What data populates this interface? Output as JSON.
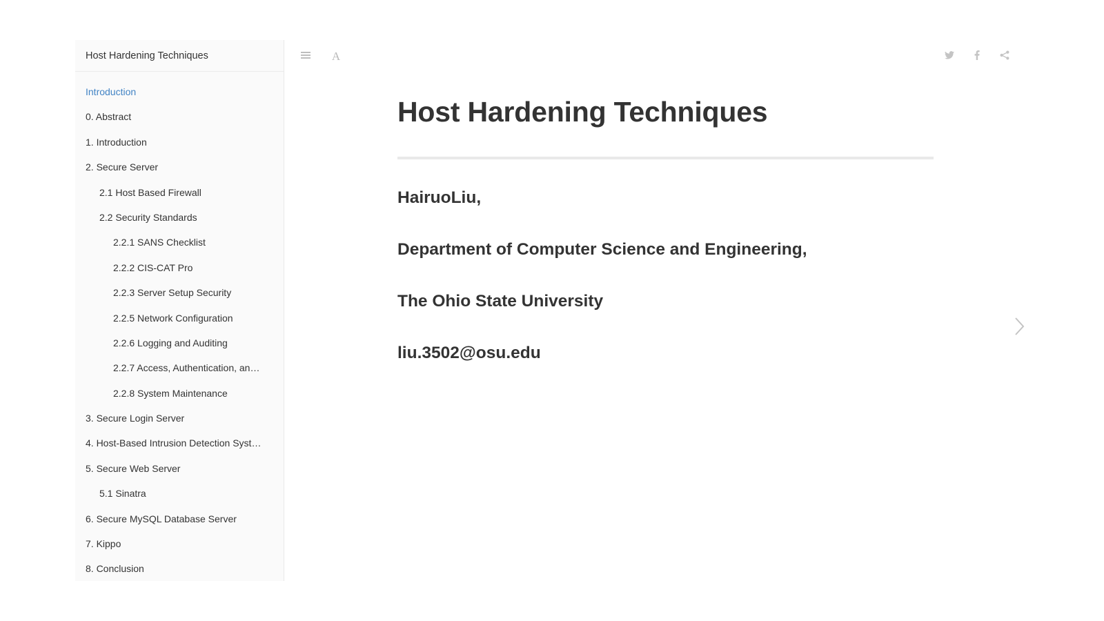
{
  "book": {
    "title": "Host Hardening Techniques"
  },
  "sidebar": {
    "items": [
      {
        "label": "Introduction",
        "level": 0,
        "active": true
      },
      {
        "label": "0. Abstract",
        "level": 0
      },
      {
        "label": "1. Introduction",
        "level": 0
      },
      {
        "label": "2. Secure Server",
        "level": 0
      },
      {
        "label": "2.1 Host Based Firewall",
        "level": 1
      },
      {
        "label": "2.2 Security Standards",
        "level": 1
      },
      {
        "label": "2.2.1 SANS Checklist",
        "level": 2
      },
      {
        "label": "2.2.2 CIS-CAT Pro",
        "level": 2
      },
      {
        "label": "2.2.3 Server Setup Security",
        "level": 2
      },
      {
        "label": "2.2.5 Network Configuration",
        "level": 2
      },
      {
        "label": "2.2.6 Logging and Auditing",
        "level": 2
      },
      {
        "label": "2.2.7 Access, Authentication, an…",
        "level": 2
      },
      {
        "label": "2.2.8 System Maintenance",
        "level": 2
      },
      {
        "label": "3. Secure Login Server",
        "level": 0
      },
      {
        "label": "4. Host-Based Intrusion Detection Syst…",
        "level": 0
      },
      {
        "label": "5. Secure Web Server",
        "level": 0
      },
      {
        "label": "5.1 Sinatra",
        "level": 1
      },
      {
        "label": "6. Secure MySQL Database Server",
        "level": 0
      },
      {
        "label": "7. Kippo",
        "level": 0
      },
      {
        "label": "8. Conclusion",
        "level": 0
      }
    ]
  },
  "toolbar": {
    "menu_icon": "hamburger-icon",
    "font_label": "A",
    "social": [
      "twitter-icon",
      "facebook-icon",
      "share-icon"
    ]
  },
  "page": {
    "title": "Host Hardening Techniques",
    "author": "HairuoLiu,",
    "department": "Department of Computer Science and Engineering,",
    "university": "The Ohio State University",
    "email": "liu.3502@osu.edu"
  },
  "colors": {
    "active_link": "#4183c4",
    "text": "#333333",
    "icon_gray": "#b9b9b9",
    "sidebar_bg": "#fafafa"
  }
}
